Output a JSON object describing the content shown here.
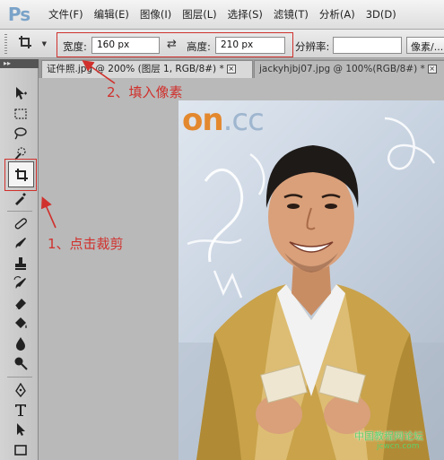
{
  "app": {
    "logo": "Ps"
  },
  "menu": {
    "items": [
      "文件(F)",
      "编辑(E)",
      "图像(I)",
      "图层(L)",
      "选择(S)",
      "滤镜(T)",
      "分析(A)",
      "3D(D)"
    ]
  },
  "options": {
    "width_label": "宽度:",
    "width_value": "160 px",
    "height_label": "高度:",
    "height_value": "210 px",
    "resolution_label": "分辨率:",
    "resolution_value": "",
    "resolution_unit": "像素/..."
  },
  "tabs": [
    {
      "label": "证件照.jpg @ 200% (图层 1, RGB/8#) *",
      "active": true,
      "close": "×"
    },
    {
      "label": "jackyhjbj07.jpg @ 100%(RGB/8#) *",
      "active": false,
      "close": "×"
    }
  ],
  "toolbox": {
    "collapse_label": "▸▸"
  },
  "photo": {
    "watermark_main": "on",
    "watermark_suffix": ".cc",
    "footer_line1": "中国教程网论坛",
    "footer_line2": "jcwcn.com"
  },
  "annotations": {
    "step1": "1、点击裁剪",
    "step2": "2、填入像素"
  },
  "colors": {
    "annotation": "#d0312d",
    "watermark_orange": "#e3882e",
    "watermark_green": "#5fd06a"
  }
}
